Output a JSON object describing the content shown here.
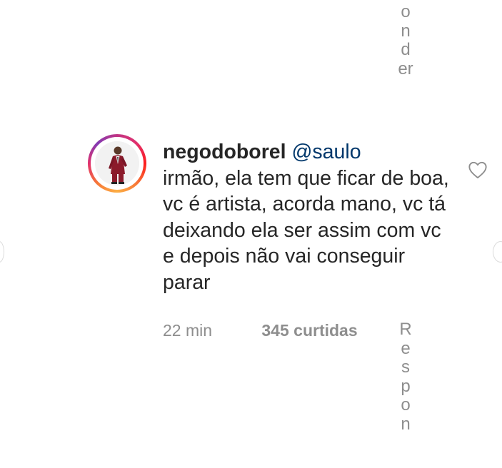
{
  "reply_top": {
    "label_fragment": [
      "o",
      "n",
      "d",
      "er"
    ]
  },
  "comment": {
    "username": "negodoborel",
    "mention": "@saulo",
    "text": "irmão, ela tem que ficar de boa, vc é artista, acorda mano, vc tá  deixando ela ser assim com vc e depois não vai conseguir parar",
    "time": "22 min",
    "likes": "345 curtidas",
    "reply_label_chars": [
      "R",
      "e",
      "s",
      "p",
      "o",
      "n"
    ]
  },
  "icons": {
    "like": "heart-outline-icon",
    "avatar": "profile-photo",
    "nav_left": "carousel-prev-icon",
    "nav_right": "carousel-next-icon"
  },
  "colors": {
    "text": "#262626",
    "secondary": "#8e8e8e",
    "mention": "#00376b",
    "story_ring": "#e1306c"
  }
}
